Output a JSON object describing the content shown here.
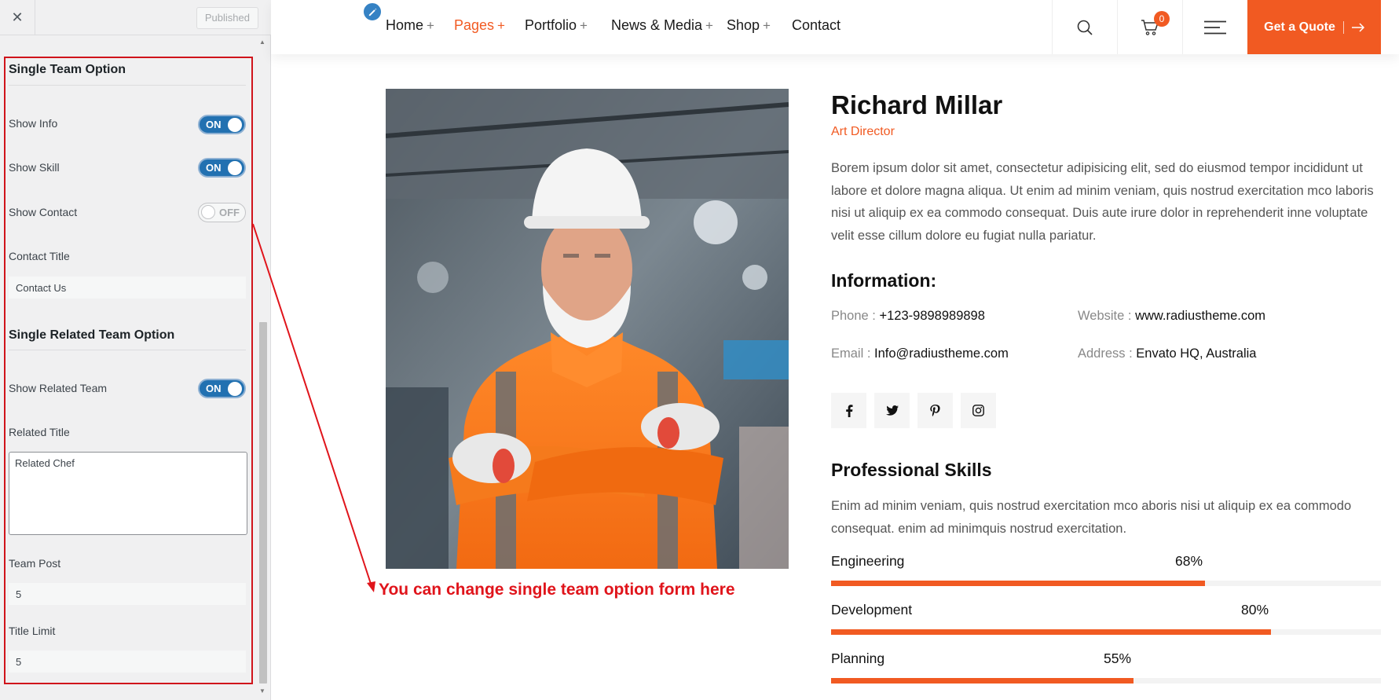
{
  "sidebar": {
    "close_glyph": "✕",
    "published_label": "Published",
    "single_team": {
      "title": "Single Team Option",
      "show_info": {
        "label": "Show Info",
        "state": "ON"
      },
      "show_skill": {
        "label": "Show Skill",
        "state": "ON"
      },
      "show_contact": {
        "label": "Show Contact",
        "state": "OFF"
      },
      "contact_title": {
        "label": "Contact Title",
        "value": "Contact Us"
      }
    },
    "related_team": {
      "title": "Single Related Team Option",
      "show_related": {
        "label": "Show Related Team",
        "state": "ON"
      },
      "related_title": {
        "label": "Related Title",
        "value": "Related Chef"
      },
      "team_post": {
        "label": "Team Post",
        "value": "5"
      },
      "title_limit": {
        "label": "Title Limit",
        "value": "5"
      }
    }
  },
  "header": {
    "nav": [
      {
        "label": "Home",
        "plus": "+",
        "active": false
      },
      {
        "label": "Pages",
        "plus": "+",
        "active": true
      },
      {
        "label": "Portfolio",
        "plus": "+",
        "active": false
      },
      {
        "label": "News & Media",
        "plus": "+",
        "active": false
      },
      {
        "label": "Shop",
        "plus": "+",
        "active": false
      },
      {
        "label": "Contact",
        "plus": "",
        "active": false
      }
    ],
    "cart_count": "0",
    "quote_label": "Get a Quote",
    "accent_color": "#f15a22"
  },
  "annotation": "You can change single team option form here",
  "profile": {
    "name": "Richard Millar",
    "role": "Art Director",
    "bio": "Borem ipsum dolor sit amet, consectetur adipisicing elit, sed do eiusmod tempor incididunt ut labore et dolore magna aliqua. Ut enim ad minim veniam, quis nostrud exercitation mco laboris nisi ut aliquip ex ea commodo consequat. Duis aute irure dolor in reprehenderit inne voluptate velit esse cillum dolore eu fugiat nulla pariatur.",
    "info_heading": "Information:",
    "phone": {
      "label": "Phone :",
      "value": "+123-9898989898"
    },
    "website": {
      "label": "Website :",
      "value": "www.radiustheme.com"
    },
    "email": {
      "label": "Email :",
      "value": "Info@radiustheme.com"
    },
    "address": {
      "label": "Address :",
      "value": "Envato HQ, Australia"
    },
    "social_icons": [
      "facebook-icon",
      "twitter-icon",
      "pinterest-icon",
      "instagram-icon"
    ],
    "skills_heading": "Professional Skills",
    "skills_intro": "Enim ad minim veniam, quis nostrud exercitation mco aboris nisi ut aliquip ex ea commodo consequat. enim ad minimquis nostrud exercitation.",
    "skills": [
      {
        "name": "Engineering",
        "percent": 68,
        "label": "68%"
      },
      {
        "name": "Development",
        "percent": 80,
        "label": "80%"
      },
      {
        "name": "Planning",
        "percent": 55,
        "label": "55%"
      }
    ]
  }
}
